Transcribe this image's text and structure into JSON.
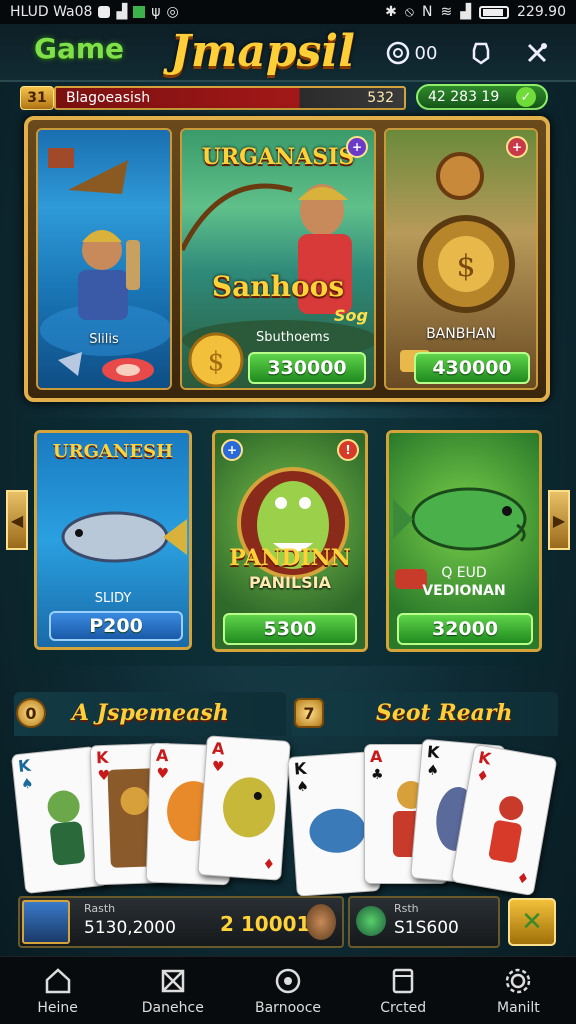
{
  "status_bar": {
    "left_text": "HLUD Wa08",
    "time": "229.90"
  },
  "header": {
    "game_label": "Game",
    "app_title": "Jmapsil",
    "coin_icon_label": "00"
  },
  "info_strip": {
    "level": "31",
    "player_name": "Blagoeasish",
    "player_number": "532",
    "coins": "42 283 19"
  },
  "featured": [
    {
      "title": "",
      "subtitle": "Slilis",
      "price": ""
    },
    {
      "title": "URGANASIS",
      "subtitle": "Sanhoos",
      "tag": "Sog",
      "label": "Sbuthoems",
      "price": "330000"
    },
    {
      "title": "",
      "subtitle": "BANBHAN",
      "price": "430000"
    }
  ],
  "game_cards": [
    {
      "title": "URGANESH",
      "subtitle": "SLIDY",
      "price": "P200"
    },
    {
      "title": "PANDINN",
      "subtitle": "PANILSIA",
      "price": "5300"
    },
    {
      "title": "Q   EUD",
      "subtitle": "VEDIONAN",
      "price": "32000"
    }
  ],
  "card_sections": [
    {
      "badge": "0",
      "title": "A Jspemeash"
    },
    {
      "badge": "7",
      "title": "Seot Rearh"
    }
  ],
  "player_bar": {
    "left_label": "Rasth",
    "left_value": "5130,2000",
    "middle_value": "2 10001",
    "right_label": "Rsth",
    "right_value": "S1S600"
  },
  "nav": [
    {
      "label": "Heine",
      "icon": "home-icon"
    },
    {
      "label": "Danehce",
      "icon": "crossed-box-icon"
    },
    {
      "label": "Barnooce",
      "icon": "circle-icon"
    },
    {
      "label": "Crcted",
      "icon": "tablet-icon"
    },
    {
      "label": "Manilt",
      "icon": "gear-icon"
    }
  ],
  "colors": {
    "accent_gold": "#ffcf3a",
    "accent_green": "#5fd44a",
    "frame_gold": "#e2b04a"
  }
}
